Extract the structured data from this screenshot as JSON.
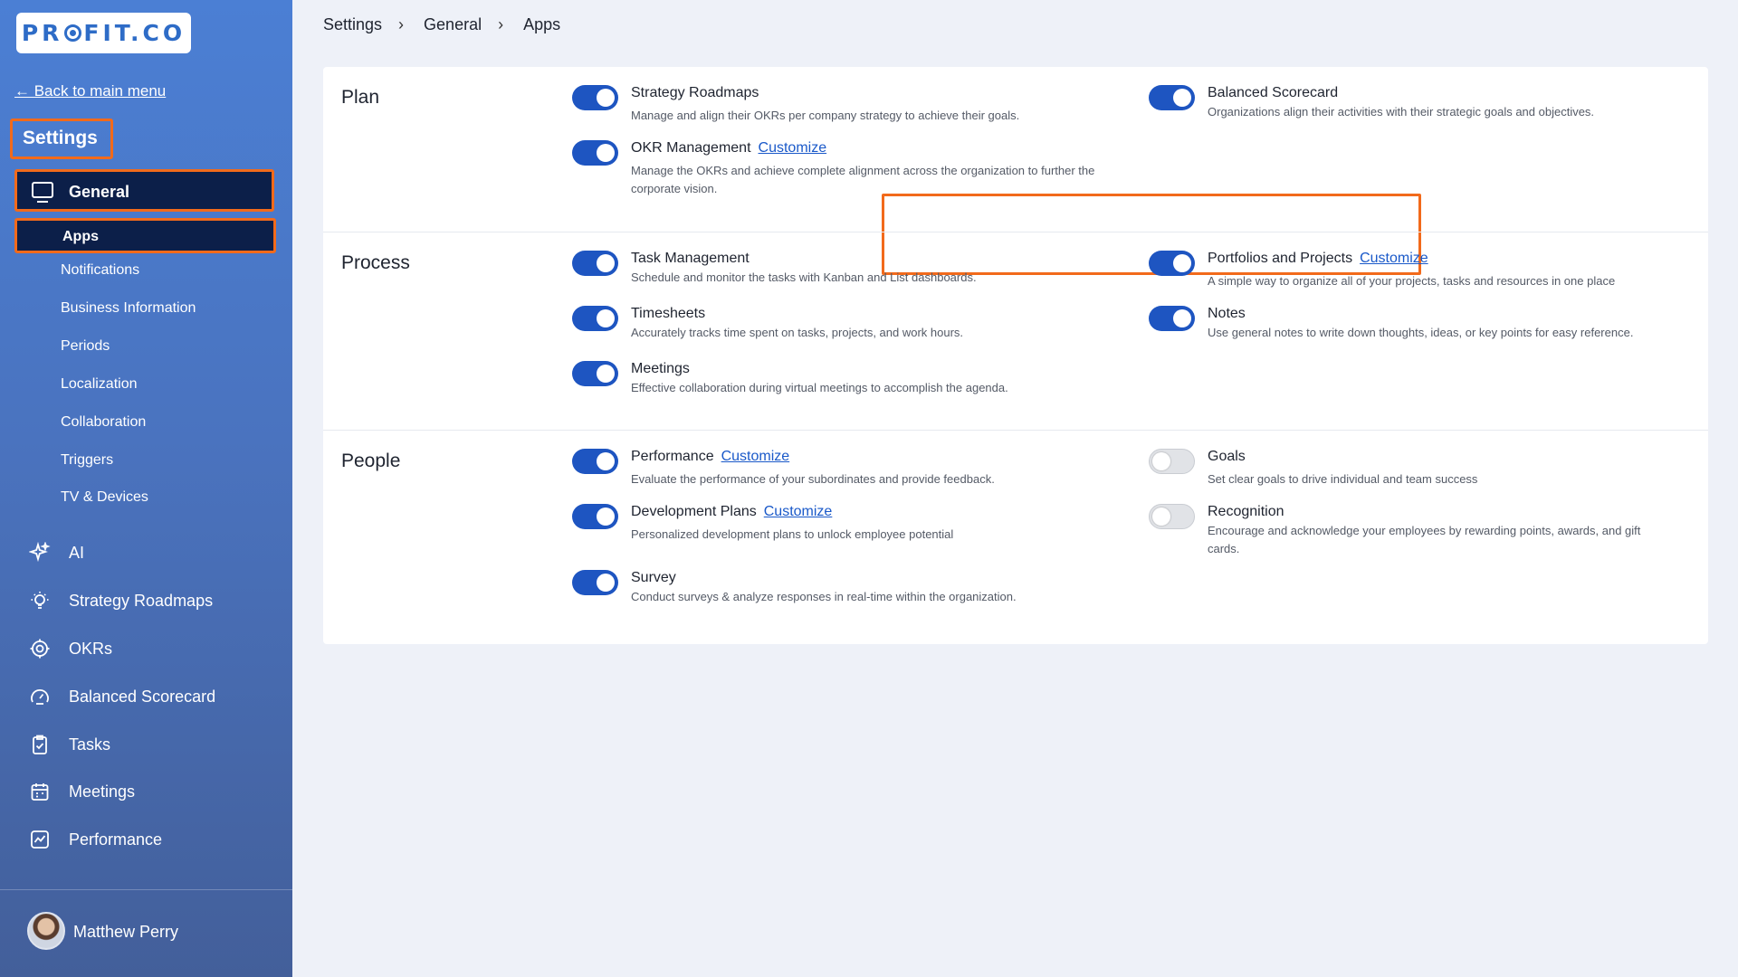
{
  "sidebar": {
    "logo": "PROFIT.CO",
    "back_link": "← Back to main menu",
    "settings_title": "Settings",
    "general_label": "General",
    "apps_label": "Apps",
    "sub_items": [
      "Notifications",
      "Business Information",
      "Periods",
      "Localization",
      "Collaboration",
      "Triggers",
      "TV & Devices"
    ],
    "main_items": [
      {
        "label": "AI",
        "icon": "sparkle-icon"
      },
      {
        "label": "Strategy Roadmaps",
        "icon": "lightbulb-icon"
      },
      {
        "label": "OKRs",
        "icon": "target-icon"
      },
      {
        "label": "Balanced Scorecard",
        "icon": "gauge-icon"
      },
      {
        "label": "Tasks",
        "icon": "clipboard-check-icon"
      },
      {
        "label": "Meetings",
        "icon": "calendar-icon"
      },
      {
        "label": "Performance",
        "icon": "chart-line-icon"
      }
    ],
    "user_name": "Matthew Perry"
  },
  "breadcrumb": [
    "Settings",
    "General",
    "Apps"
  ],
  "sections": {
    "plan": {
      "label": "Plan",
      "apps": [
        {
          "name": "Strategy Roadmaps",
          "desc": "Manage and align their OKRs per company strategy to achieve their goals.",
          "enabled": true
        },
        {
          "name": "Balanced Scorecard",
          "desc": "Organizations align their activities with their strategic goals and objectives.",
          "enabled": true
        },
        {
          "name": "OKR Management",
          "customize": "Customize",
          "desc": "Manage the OKRs and achieve complete alignment across the organization to further the corporate vision.",
          "enabled": true
        }
      ]
    },
    "process": {
      "label": "Process",
      "apps": [
        {
          "name": "Task Management",
          "desc": "Schedule and monitor the tasks with Kanban and List dashboards.",
          "enabled": true
        },
        {
          "name": "Portfolios and Projects",
          "customize": "Customize",
          "desc": "A simple way to organize all of your projects, tasks and resources in one place",
          "enabled": true
        },
        {
          "name": "Timesheets",
          "desc": "Accurately tracks time spent on tasks, projects, and work hours.",
          "enabled": true
        },
        {
          "name": "Notes",
          "desc": "Use general notes to write down thoughts, ideas, or key points for easy reference.",
          "enabled": true
        },
        {
          "name": "Meetings",
          "desc": "Effective collaboration during virtual meetings to accomplish the agenda.",
          "enabled": true
        }
      ]
    },
    "people": {
      "label": "People",
      "apps": [
        {
          "name": "Performance",
          "customize": "Customize",
          "desc": "Evaluate the performance of your subordinates and provide feedback.",
          "enabled": true
        },
        {
          "name": "Goals",
          "desc": "Set clear goals to drive individual and team success",
          "enabled": false
        },
        {
          "name": "Development Plans",
          "customize": "Customize",
          "desc": "Personalized development plans to unlock employee potential",
          "enabled": true
        },
        {
          "name": "Recognition",
          "desc": "Encourage and acknowledge your employees by rewarding points, awards, and gift cards.",
          "enabled": false
        },
        {
          "name": "Survey",
          "desc": "Conduct surveys & analyze responses in real-time within the organization.",
          "enabled": true
        }
      ]
    }
  },
  "colors": {
    "accent": "#1e55c1",
    "highlight": "#f26a1b",
    "nav_active": "#0c1f49"
  }
}
